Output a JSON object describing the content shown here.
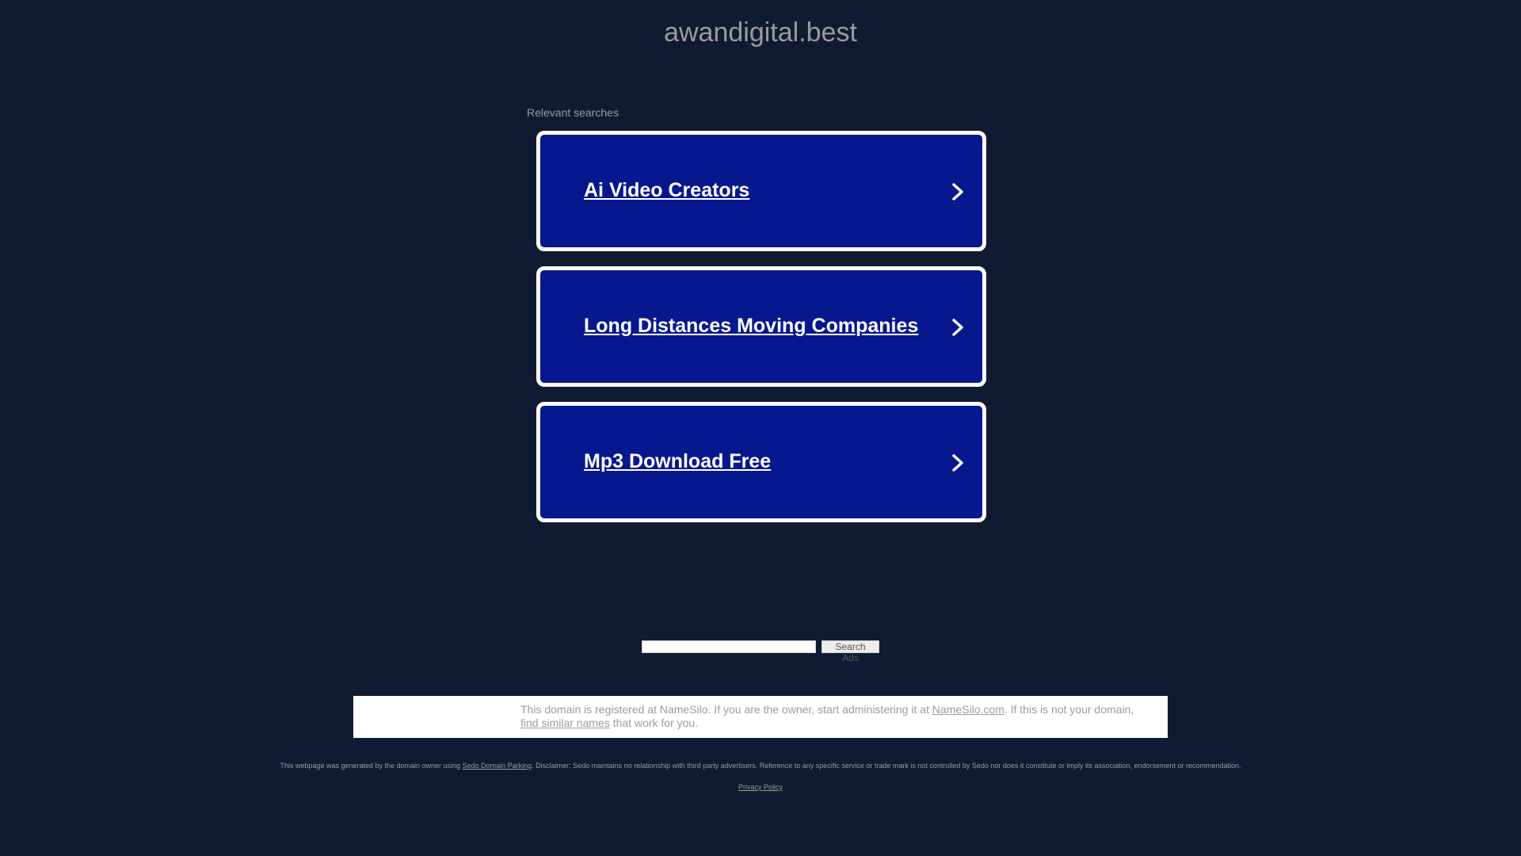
{
  "header": {
    "domain": "awandigital.best"
  },
  "relevant": {
    "label": "Relevant searches",
    "items": [
      {
        "label": "Ai Video Creators"
      },
      {
        "label": "Long Distances Moving Companies"
      },
      {
        "label": "Mp3 Download Free"
      }
    ]
  },
  "search": {
    "value": "",
    "button_label": "Search Ads"
  },
  "info": {
    "text_1": "This domain is registered at NameSilo. If you are the owner, start administering it at ",
    "link_1": "NameSilo.com",
    "text_2": ". If this is not your domain, ",
    "link_2": "find similar names",
    "text_3": " that work for you."
  },
  "footer": {
    "disclaimer_1": "This webpage was generated by the domain owner using ",
    "disclaimer_link": "Sedo Domain Parking",
    "disclaimer_2": ". Disclaimer: Sedo maintains no relationship with third party advertisers. Reference to any specific service or trade mark is not controlled by Sedo nor does it constitute or imply its association, endorsement or recommendation.",
    "privacy_label": "Privacy Policy"
  },
  "colors": {
    "background": "#101b33",
    "card_fill": "#07188e",
    "card_border": "#ffffff",
    "muted_text": "#9b9b9b"
  }
}
